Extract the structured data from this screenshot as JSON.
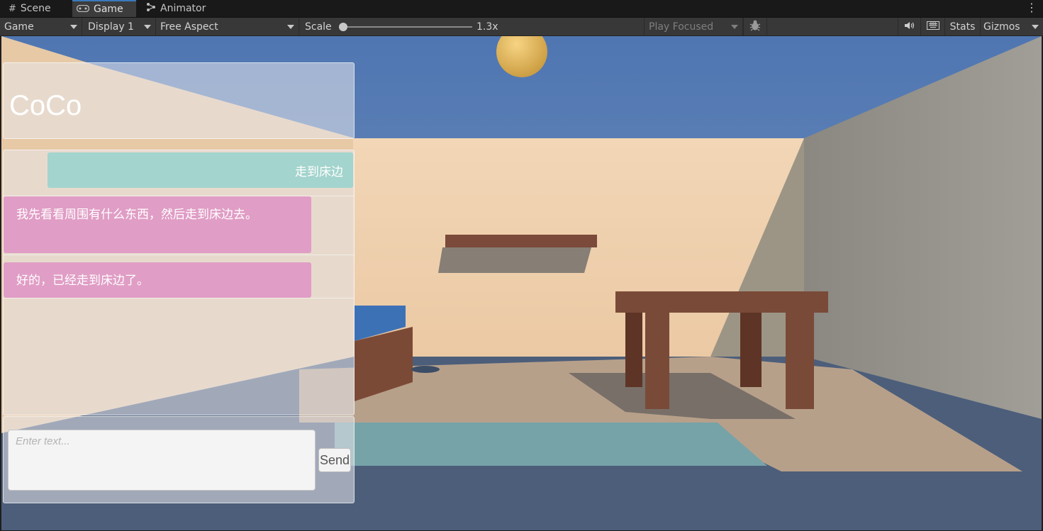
{
  "tabs": [
    {
      "label": "Scene",
      "icon": "grid-icon"
    },
    {
      "label": "Game",
      "icon": "gamepad-icon"
    },
    {
      "label": "Animator",
      "icon": "animator-icon"
    }
  ],
  "toolbar": {
    "view_mode": "Game",
    "display": "Display 1",
    "aspect": "Free Aspect",
    "scale_label": "Scale",
    "scale_value": "1.3x",
    "play_focused": "Play Focused",
    "stats_label": "Stats",
    "gizmos_label": "Gizmos"
  },
  "chat": {
    "title": "CoCo",
    "messages": [
      {
        "role": "user",
        "text": "走到床边"
      },
      {
        "role": "assistant",
        "text": "我先看看周围有什么东西，然后走到床边去。"
      },
      {
        "role": "assistant",
        "text": "好的，已经走到床边了。"
      }
    ],
    "input_placeholder": "Enter text...",
    "send_label": "Send"
  },
  "colors": {
    "tab_accent": "#3a79bb",
    "user_bubble": "#96d2cd",
    "assistant_bubble": "#de8cc3",
    "sky": "#6c8fbf",
    "wall": "#f0d3b0"
  }
}
